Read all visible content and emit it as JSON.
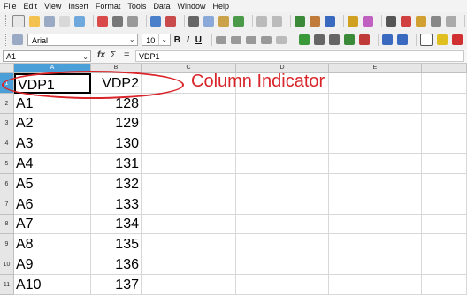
{
  "menubar": {
    "items": [
      "File",
      "Edit",
      "View",
      "Insert",
      "Format",
      "Tools",
      "Data",
      "Window",
      "Help"
    ]
  },
  "toolbar": {
    "font_name": "Arial",
    "font_size": "10",
    "bold": "B",
    "italic": "I",
    "underline": "U"
  },
  "formula_bar": {
    "cell_ref": "A1",
    "fx": "fx",
    "sigma": "Σ",
    "equals": "=",
    "content": "VDP1"
  },
  "sheet": {
    "columns": [
      "A",
      "B",
      "C",
      "D",
      "E"
    ],
    "rows": [
      {
        "num": "1",
        "a": "VDP1",
        "b": "VDP2"
      },
      {
        "num": "2",
        "a": "A1",
        "b": "128"
      },
      {
        "num": "3",
        "a": "A2",
        "b": "129"
      },
      {
        "num": "4",
        "a": "A3",
        "b": "130"
      },
      {
        "num": "5",
        "a": "A4",
        "b": "131"
      },
      {
        "num": "6",
        "a": "A5",
        "b": "132"
      },
      {
        "num": "7",
        "a": "A6",
        "b": "133"
      },
      {
        "num": "8",
        "a": "A7",
        "b": "134"
      },
      {
        "num": "9",
        "a": "A8",
        "b": "135"
      },
      {
        "num": "10",
        "a": "A9",
        "b": "136"
      },
      {
        "num": "11",
        "a": "A10",
        "b": "137"
      }
    ]
  },
  "annotation": {
    "label": "Column Indicator",
    "color": "#d9252a"
  },
  "colors": {
    "selected_header": "#4a9fd9"
  }
}
